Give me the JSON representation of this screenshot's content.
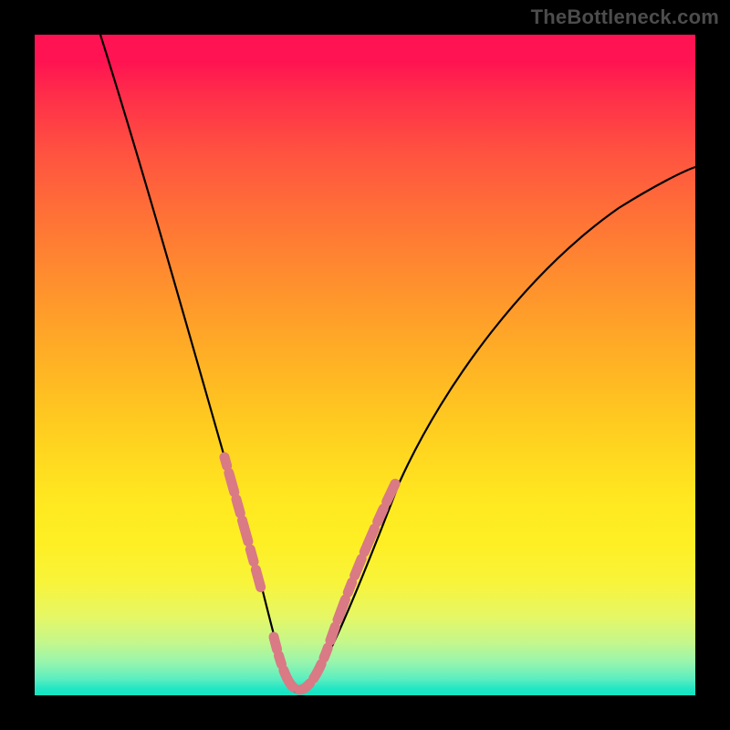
{
  "attribution": "TheBottleneck.com",
  "chart_data": {
    "type": "line",
    "title": "",
    "xlabel": "",
    "ylabel": "",
    "xlim": [
      0,
      100
    ],
    "ylim": [
      0,
      100
    ],
    "grid": false,
    "legend": false,
    "series": [
      {
        "name": "bottleneck-curve",
        "color": "#000000",
        "x": [
          10,
          14,
          18,
          22,
          25,
          27,
          29,
          31,
          33,
          35,
          36,
          37,
          38,
          40,
          42,
          44,
          46,
          50,
          55,
          60,
          65,
          70,
          78,
          86,
          94,
          100
        ],
        "values": [
          100,
          88,
          76,
          62,
          50,
          42,
          34,
          26,
          18,
          10,
          6,
          2,
          1,
          1,
          3,
          7,
          12,
          22,
          33,
          42,
          50,
          56,
          64,
          71,
          77,
          80
        ]
      },
      {
        "name": "highlight-segment-left",
        "color": "#d97a85",
        "x": [
          27,
          29,
          31,
          33,
          35,
          36
        ],
        "values": [
          42,
          34,
          26,
          18,
          10,
          6
        ]
      },
      {
        "name": "highlight-segment-bottom",
        "color": "#d97a85",
        "x": [
          36,
          37,
          38,
          40,
          42,
          44
        ],
        "values": [
          6,
          2,
          1,
          1,
          3,
          7
        ]
      },
      {
        "name": "highlight-segment-right",
        "color": "#d97a85",
        "x": [
          44,
          46,
          50,
          55
        ],
        "values": [
          7,
          12,
          22,
          33
        ]
      }
    ],
    "gradient_stops": [
      {
        "pos": 0,
        "color": "#ff1352"
      },
      {
        "pos": 0.2,
        "color": "#ff6a3a"
      },
      {
        "pos": 0.45,
        "color": "#ffa528"
      },
      {
        "pos": 0.65,
        "color": "#ffda20"
      },
      {
        "pos": 0.82,
        "color": "#feef24"
      },
      {
        "pos": 0.93,
        "color": "#b8f694"
      },
      {
        "pos": 1.0,
        "color": "#12e3c1"
      }
    ]
  }
}
